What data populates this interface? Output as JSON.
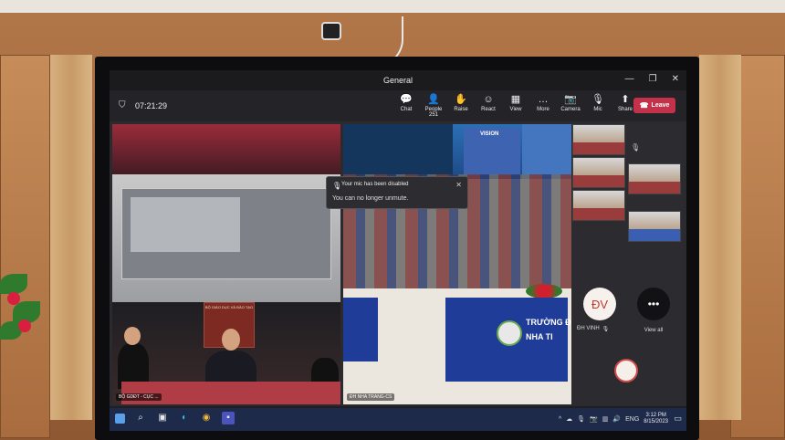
{
  "window": {
    "title": "General"
  },
  "meeting": {
    "timer": "07:21:29"
  },
  "toolbar": {
    "items": [
      {
        "label": "Chat",
        "icon": "chat-icon",
        "glyph": "💬",
        "count": ""
      },
      {
        "label": "People",
        "icon": "people-icon",
        "glyph": "👤",
        "count": "251"
      },
      {
        "label": "Raise",
        "icon": "raise-hand-icon",
        "glyph": "✋",
        "count": ""
      },
      {
        "label": "React",
        "icon": "react-icon",
        "glyph": "☺",
        "count": ""
      },
      {
        "label": "View",
        "icon": "view-icon",
        "glyph": "▦",
        "count": ""
      },
      {
        "label": "More",
        "icon": "more-icon",
        "glyph": "…",
        "count": ""
      },
      {
        "label": "Camera",
        "icon": "camera-off-icon",
        "glyph": "📷",
        "count": ""
      },
      {
        "label": "Mic",
        "icon": "mic-off-icon",
        "glyph": "🎙",
        "count": ""
      },
      {
        "label": "Share",
        "icon": "share-icon",
        "glyph": "⬆",
        "count": ""
      }
    ],
    "leave_label": "Leave"
  },
  "toast": {
    "title": "Your mic has been disabled",
    "body": "You can no longer unmute."
  },
  "stage": {
    "left_tile_name": "BỘ GDĐT - CỤC ...",
    "left_podium_text": "BỘ GIÁO DỤC VÀ ĐÀO TẠO",
    "mid_tile_name": "ĐH NHA TRANG-CS",
    "vision_title": "VISION",
    "banner_line1": "TRƯỜNG Đ",
    "banner_line2": "NHA TI"
  },
  "participants": {
    "avatar_initials": "ĐV",
    "avatar_name": "ĐH VINH",
    "view_all_label": "View all",
    "more_glyph": "•••"
  },
  "taskbar": {
    "language": "ENG",
    "time": "3:12 PM",
    "date": "8/15/2023"
  },
  "colors": {
    "leave": "#c4314b",
    "toolbar_bg": "#242428",
    "taskbar_bg": "#1d2a4a"
  }
}
